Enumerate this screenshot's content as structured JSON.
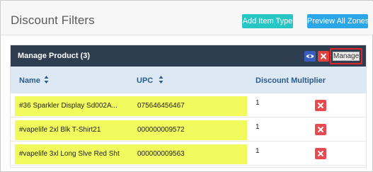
{
  "header": {
    "title": "Discount Filters",
    "add_item_type_label": "Add Item Type",
    "preview_all_zones_label": "Preview All Zones"
  },
  "panel": {
    "title": "Manage Product (3)",
    "manage_label": "Manage"
  },
  "table": {
    "columns": [
      "Name",
      "UPC",
      "Discount Multiplier"
    ],
    "rows": [
      {
        "name": "#36 Sparkler Display Sd002A...",
        "upc": "075646456467",
        "multiplier": "1"
      },
      {
        "name": "#vapelife 2xl Blk T-Shirt21",
        "upc": "000000009572",
        "multiplier": "1"
      },
      {
        "name": "#vapelife 3xl Long Slve Red Sht",
        "upc": "000000009563",
        "multiplier": "1"
      }
    ]
  },
  "colors": {
    "panel_header": "#2e3e50",
    "teal_button": "#26c6c4",
    "blue_button": "#2ba6e6",
    "delete_red": "#e84a4f",
    "highlight": "#f1fb5d",
    "manage_outline": "#e0262a"
  },
  "icons": [
    "eye-icon",
    "close-icon",
    "sort-icon",
    "delete-icon"
  ]
}
